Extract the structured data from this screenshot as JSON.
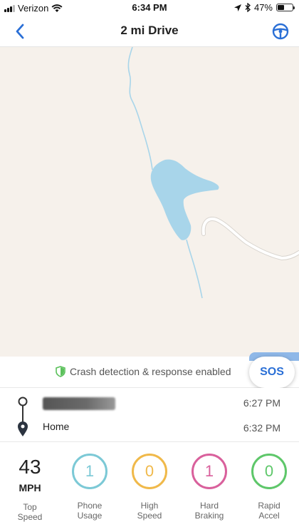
{
  "status_bar": {
    "carrier": "Verizon",
    "time": "6:34 PM",
    "battery": "47%",
    "battery_level": 0.47,
    "icons": [
      "signal-icon",
      "wifi-icon",
      "location-arrow-icon",
      "bluetooth-icon",
      "battery-icon"
    ]
  },
  "nav": {
    "title": "2 mi Drive",
    "back_icon": "chevron-left-icon",
    "action_icon": "steering-wheel-icon",
    "accent": "#2a6fd6"
  },
  "map": {
    "water_color": "#a8d5ea",
    "land_color": "#f6f1eb",
    "road_color": "#ffffff"
  },
  "crash_detection": {
    "text": "Crash detection & response enabled",
    "icon": "shield-icon",
    "icon_color": "#5cc15c",
    "sos_label": "SOS"
  },
  "route": {
    "start_time": "6:27 PM",
    "end_label": "Home",
    "end_time": "6:32 PM",
    "start_icon": "origin-pin-icon",
    "end_icon": "destination-pin-icon"
  },
  "stats": {
    "top_speed": {
      "value": "43",
      "unit": "MPH",
      "label_line1": "Top",
      "label_line2": "Speed"
    },
    "items": [
      {
        "value": "1",
        "label_line1": "Phone",
        "label_line2": "Usage",
        "color": "#7cc9d6"
      },
      {
        "value": "0",
        "label_line1": "High",
        "label_line2": "Speed",
        "color": "#f0b94a"
      },
      {
        "value": "1",
        "label_line1": "Hard",
        "label_line2": "Braking",
        "color": "#d9609c"
      },
      {
        "value": "0",
        "label_line1": "Rapid",
        "label_line2": "Accel",
        "color": "#5ec76a"
      }
    ]
  }
}
